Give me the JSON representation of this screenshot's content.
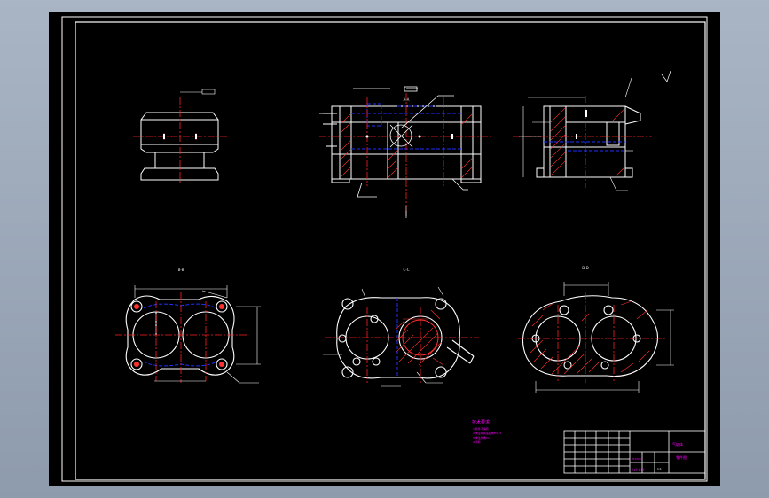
{
  "colors": {
    "background_outer": "#9aa6b6",
    "paper": "#000000",
    "frame": "#ffffff",
    "outline": "#ffffff",
    "center_line": "#ff2020",
    "hidden": "#2030ff",
    "hatch": "#ff3030",
    "note_text": "#ff00ff",
    "section_mark": "#e8e8e8"
  },
  "drawing": {
    "section_labels": [
      "A-A",
      "B-B",
      "C-C",
      "D-D"
    ],
    "notes": {
      "heading": "技术要求",
      "lines": [
        "1.铸件不得有",
        "2.未注明铸造圆角R3~5",
        "3.未注倒角C1",
        "4.清砂"
      ]
    },
    "title_block": {
      "part_name": "气缸体",
      "part_label": "零件图",
      "scale": "1:1",
      "material": "HT200",
      "sheet": "共1张 第1张"
    }
  }
}
